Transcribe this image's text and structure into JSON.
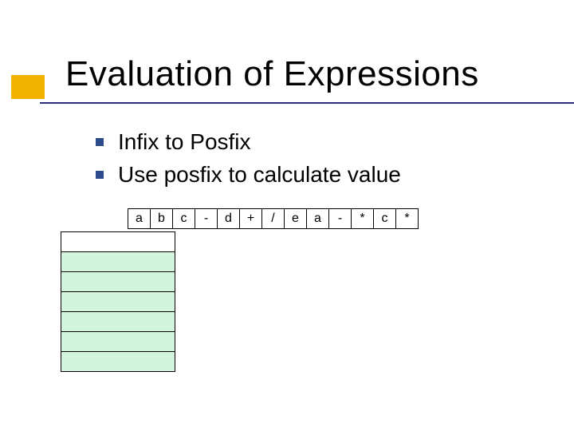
{
  "title": "Evaluation of Expressions",
  "bullets": [
    "Infix to Posfix",
    "Use  posfix to calculate value"
  ],
  "tokens": [
    "a",
    "b",
    "c",
    "-",
    "d",
    "+",
    "/",
    "e",
    "a",
    "-",
    "*",
    "c",
    "*"
  ],
  "stack": {
    "total_rows": 7,
    "filled_rows": 6
  },
  "colors": {
    "accent": "#f1b300",
    "underline": "#2c2c7a",
    "bullet_square": "#2d4a8a",
    "stack_fill": "#d4f5dd"
  }
}
